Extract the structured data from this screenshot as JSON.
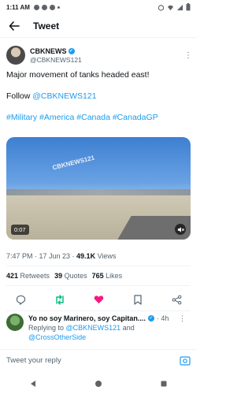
{
  "status_bar": {
    "time": "1:11 AM"
  },
  "header": {
    "title": "Tweet"
  },
  "author": {
    "name": "CBKNEWS",
    "handle": "@CBKNEWS121"
  },
  "tweet": {
    "line1": "Major movement of tanks headed east!",
    "follow_prefix": "Follow ",
    "follow_handle": "@CBKNEWS121",
    "hashtags": [
      "#Military",
      "#America",
      "#Canada",
      "#CanadaGP"
    ]
  },
  "media": {
    "watermark": "CBKNEWS121",
    "duration": "0:07"
  },
  "meta": {
    "time_date": "7:47 PM · 17 Jun 23 · ",
    "views_count": "49.1K",
    "views_label": " Views"
  },
  "stats": {
    "retweets_count": "421",
    "retweets_label": " Retweets",
    "quotes_count": "39",
    "quotes_label": " Quotes",
    "likes_count": "765",
    "likes_label": " Likes"
  },
  "reply": {
    "name": "Yo no soy Marinero, soy Capitan....",
    "time": "· 4h",
    "replying_prefix": "Replying to ",
    "replying_to_1": "@CBKNEWS121",
    "and": " and",
    "replying_to_2": "@CrossOtherSide"
  },
  "composer": {
    "placeholder": "Tweet your reply"
  },
  "colors": {
    "accent": "#1d9bf0",
    "like": "#f91880",
    "retweet": "#00ba7c"
  },
  "icons": [
    "back-arrow-icon",
    "verified-icon",
    "more-icon",
    "mute-icon",
    "reply-icon",
    "retweet-icon",
    "like-icon",
    "bookmark-icon",
    "share-icon",
    "image-icon",
    "nav-back-icon",
    "nav-home-icon",
    "nav-recents-icon"
  ]
}
